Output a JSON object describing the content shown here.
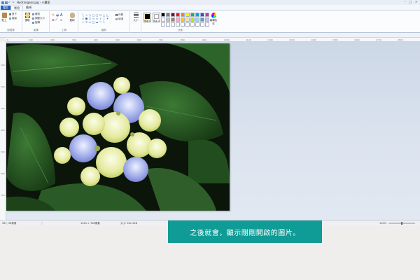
{
  "window": {
    "title": "Hydrangeas.jpg - 小畫家"
  },
  "ribbon": {
    "file_tab": "檔案",
    "tabs": [
      "常用",
      "檢視"
    ],
    "groups": {
      "clipboard": {
        "label": "剪貼簿",
        "paste": "貼上",
        "cut": "剪下",
        "copy": "複製"
      },
      "image": {
        "label": "影像",
        "select": "選取",
        "crop": "裁剪",
        "resize": "調整大小",
        "rotate": "旋轉"
      },
      "tools": {
        "label": "工具",
        "brushes": "筆刷"
      },
      "shapes": {
        "label": "圖形",
        "outline": "外框",
        "fill": "填滿"
      },
      "size": {
        "label": "大小"
      },
      "colors": {
        "label": "色彩",
        "color1": "色彩 1",
        "color2": "色彩 2",
        "edit": "編輯色彩"
      }
    }
  },
  "icons": {
    "paste": "paste-icon",
    "select": "select-icon",
    "brush": "brush-icon",
    "size": "line-size-icon",
    "edit_colors": "color-wheel-icon"
  },
  "colors": {
    "primary": "#000000",
    "secondary": "#ffffff",
    "palette": [
      "#000000",
      "#7f7f7f",
      "#880015",
      "#ed1c24",
      "#ff7f27",
      "#fff200",
      "#22b14c",
      "#00a2e8",
      "#3f48cc",
      "#a349a4",
      "#ffffff",
      "#c3c3c3",
      "#b97a57",
      "#ffaec9",
      "#ffc90e",
      "#efe4b0",
      "#b5e61d",
      "#99d9ea",
      "#7092be",
      "#c8bfe7",
      "#ffffff",
      "#ffffff",
      "#ffffff",
      "#ffffff",
      "#ffffff",
      "#ffffff",
      "#ffffff",
      "#ffffff",
      "#ffffff",
      "#ffffff"
    ]
  },
  "ruler": {
    "top_ticks": [
      "0",
      "100",
      "200",
      "300",
      "400",
      "500",
      "600",
      "700",
      "800",
      "900",
      "1000",
      "1100",
      "1200",
      "1300",
      "1400",
      "1500",
      "1600",
      "1700",
      "1800"
    ],
    "left_ticks": [
      "100",
      "200",
      "300",
      "400",
      "500",
      "600",
      "700"
    ]
  },
  "statusbar": {
    "position": "587, 98像素",
    "image_size": "1024 × 768像素",
    "file_size": "大小: 581.3KB",
    "zoom": "100%"
  },
  "caption": "之後就會，顯示剛剛開啟的圖片。"
}
